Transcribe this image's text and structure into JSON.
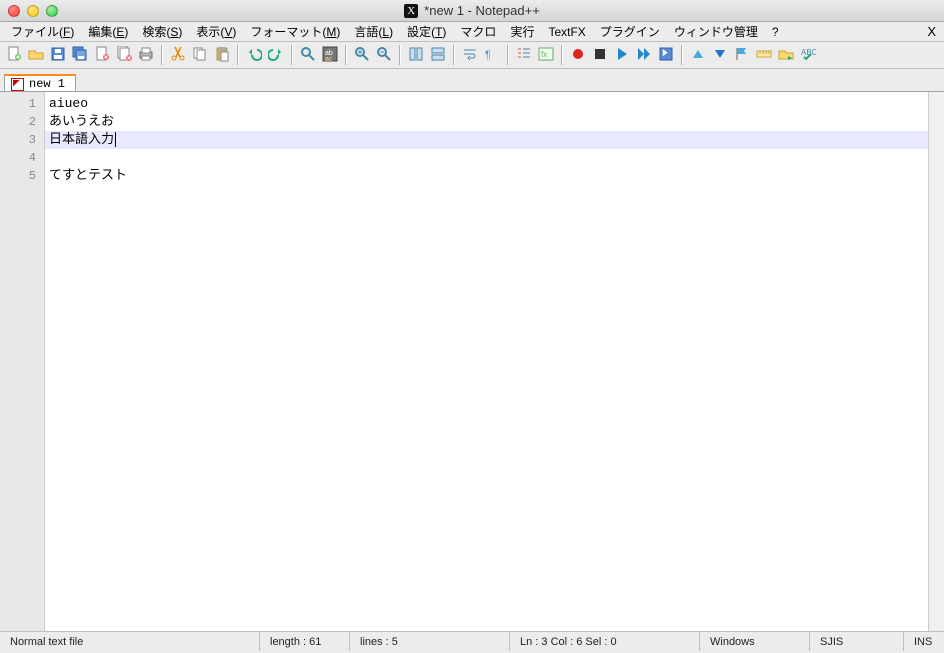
{
  "title": "*new  1 - Notepad++",
  "menu": [
    "ファイル(F)",
    "編集(E)",
    "検索(S)",
    "表示(V)",
    "フォーマット(M)",
    "言語(L)",
    "設定(T)",
    "マクロ",
    "実行",
    "TextFX",
    "プラグイン",
    "ウィンドウ管理",
    "?"
  ],
  "menu_close": "X",
  "toolbar_icons": [
    "new",
    "open",
    "save",
    "save-all",
    "close",
    "close-all",
    "print",
    "|",
    "cut",
    "copy",
    "paste",
    "|",
    "undo",
    "redo",
    "|",
    "find",
    "replace",
    "|",
    "zoom-in",
    "zoom-out",
    "|",
    "sync-v",
    "sync-h",
    "|",
    "wrap",
    "show-all",
    "|",
    "indent-guide",
    "lang",
    "|",
    "record",
    "stop",
    "play",
    "play-multi",
    "save-macro",
    "|",
    "tri-up",
    "tri-down",
    "flag",
    "ruler",
    "folder-go",
    "spell"
  ],
  "tab": {
    "label": "new  1"
  },
  "lines": [
    "aiueo",
    "あいうえお",
    "日本語入力",
    "",
    "てすとテスト"
  ],
  "active_line_index": 2,
  "status": {
    "filetype": "Normal text file",
    "length": "length : 61",
    "lines": "lines : 5",
    "pos": "Ln : 3    Col : 6    Sel : 0",
    "eol": "Windows",
    "enc": "SJIS",
    "ins": "INS"
  }
}
